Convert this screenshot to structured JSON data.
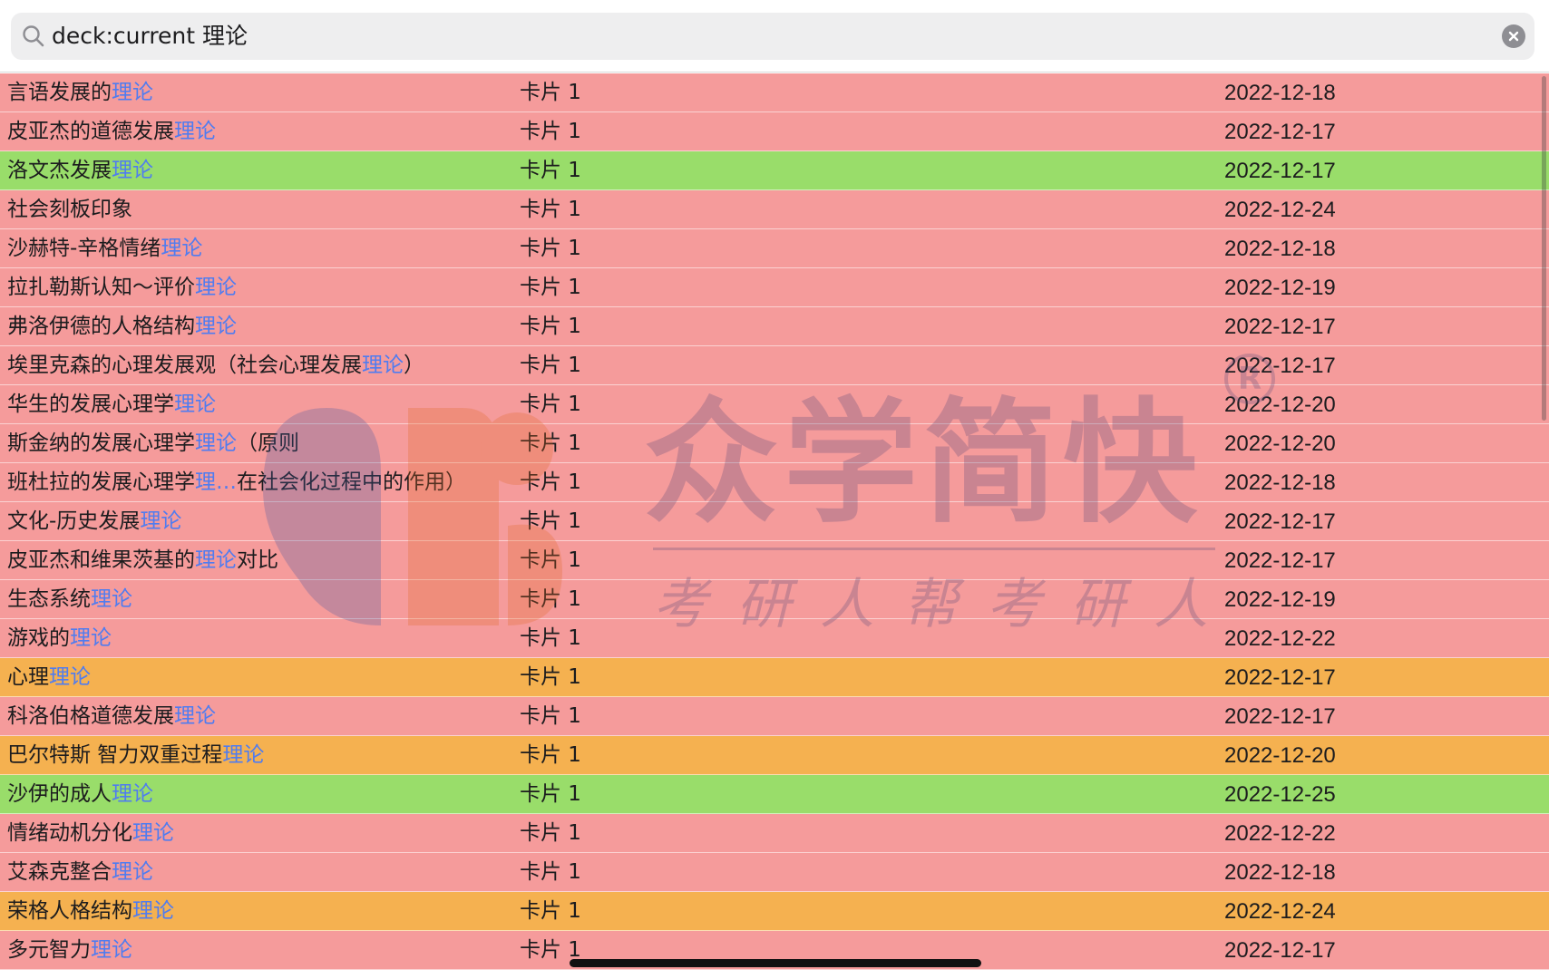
{
  "search": {
    "query": "deck:current 理论"
  },
  "colors": {
    "red": "#f59b9b",
    "green": "#99dd6a",
    "orange": "#f5b150",
    "highlight": "#4f7cf0"
  },
  "watermark": {
    "brand": "众学简快",
    "slogan": "考研人帮考研人",
    "registered": "R"
  },
  "rows": [
    {
      "color": "red",
      "q": [
        {
          "t": "言语发展的"
        },
        {
          "t": "理论",
          "hl": true
        }
      ],
      "card": "卡片 1",
      "date": "2022-12-18"
    },
    {
      "color": "red",
      "q": [
        {
          "t": "皮亚杰的道德发展"
        },
        {
          "t": "理论",
          "hl": true
        }
      ],
      "card": "卡片 1",
      "date": "2022-12-17"
    },
    {
      "color": "green",
      "q": [
        {
          "t": "洛文杰发展"
        },
        {
          "t": "理论",
          "hl": true
        }
      ],
      "card": "卡片 1",
      "date": "2022-12-17"
    },
    {
      "color": "red",
      "q": [
        {
          "t": "社会刻板印象"
        }
      ],
      "card": "卡片 1",
      "date": "2022-12-24"
    },
    {
      "color": "red",
      "q": [
        {
          "t": "沙赫特-辛格情绪"
        },
        {
          "t": "理论",
          "hl": true
        }
      ],
      "card": "卡片 1",
      "date": "2022-12-18"
    },
    {
      "color": "red",
      "q": [
        {
          "t": "拉扎勒斯认知～评价"
        },
        {
          "t": "理论",
          "hl": true
        }
      ],
      "card": "卡片 1",
      "date": "2022-12-19"
    },
    {
      "color": "red",
      "q": [
        {
          "t": "弗洛伊德的人格结构"
        },
        {
          "t": "理论",
          "hl": true
        }
      ],
      "card": "卡片 1",
      "date": "2022-12-17"
    },
    {
      "color": "red",
      "q": [
        {
          "t": "埃里克森的心理发展观（社会心理发展"
        },
        {
          "t": "理论",
          "hl": true
        },
        {
          "t": "）"
        }
      ],
      "card": "卡片 1",
      "date": "2022-12-17"
    },
    {
      "color": "red",
      "q": [
        {
          "t": "华生的发展心理学"
        },
        {
          "t": "理论",
          "hl": true
        }
      ],
      "card": "卡片 1",
      "date": "2022-12-20"
    },
    {
      "color": "red",
      "q": [
        {
          "t": "斯金纳的发展心理学"
        },
        {
          "t": "理论",
          "hl": true
        },
        {
          "t": "（原则"
        }
      ],
      "card": "卡片 1",
      "date": "2022-12-20"
    },
    {
      "color": "red",
      "q": [
        {
          "t": "班杜拉的发展心理学"
        },
        {
          "t": "理…",
          "hl": true
        },
        {
          "t": "在社会化过程中的作用）"
        }
      ],
      "card": "卡片 1",
      "date": "2022-12-18"
    },
    {
      "color": "red",
      "q": [
        {
          "t": "文化-历史发展"
        },
        {
          "t": "理论",
          "hl": true
        }
      ],
      "card": "卡片 1",
      "date": "2022-12-17"
    },
    {
      "color": "red",
      "q": [
        {
          "t": "皮亚杰和维果茨基的"
        },
        {
          "t": "理论",
          "hl": true
        },
        {
          "t": "对比"
        }
      ],
      "card": "卡片 1",
      "date": "2022-12-17"
    },
    {
      "color": "red",
      "q": [
        {
          "t": "生态系统"
        },
        {
          "t": "理论",
          "hl": true
        }
      ],
      "card": "卡片 1",
      "date": "2022-12-19"
    },
    {
      "color": "red",
      "q": [
        {
          "t": "游戏的"
        },
        {
          "t": "理论",
          "hl": true
        }
      ],
      "card": "卡片 1",
      "date": "2022-12-22"
    },
    {
      "color": "orange",
      "q": [
        {
          "t": "心理"
        },
        {
          "t": "理论",
          "hl": true
        }
      ],
      "card": "卡片 1",
      "date": "2022-12-17"
    },
    {
      "color": "red",
      "q": [
        {
          "t": "科洛伯格道德发展"
        },
        {
          "t": "理论",
          "hl": true
        }
      ],
      "card": "卡片 1",
      "date": "2022-12-17"
    },
    {
      "color": "orange",
      "q": [
        {
          "t": "巴尔特斯 智力双重过程"
        },
        {
          "t": "理论",
          "hl": true
        }
      ],
      "card": "卡片 1",
      "date": "2022-12-20"
    },
    {
      "color": "green",
      "q": [
        {
          "t": "沙伊的成人"
        },
        {
          "t": "理论",
          "hl": true
        }
      ],
      "card": "卡片 1",
      "date": "2022-12-25"
    },
    {
      "color": "red",
      "q": [
        {
          "t": "情绪动机分化"
        },
        {
          "t": "理论",
          "hl": true
        }
      ],
      "card": "卡片 1",
      "date": "2022-12-22"
    },
    {
      "color": "red",
      "q": [
        {
          "t": "艾森克整合"
        },
        {
          "t": "理论",
          "hl": true
        }
      ],
      "card": "卡片 1",
      "date": "2022-12-18"
    },
    {
      "color": "orange",
      "q": [
        {
          "t": "荣格人格结构"
        },
        {
          "t": "理论",
          "hl": true
        }
      ],
      "card": "卡片 1",
      "date": "2022-12-24"
    },
    {
      "color": "red",
      "q": [
        {
          "t": "多元智力"
        },
        {
          "t": "理论",
          "hl": true
        }
      ],
      "card": "卡片 1",
      "date": "2022-12-17"
    }
  ]
}
